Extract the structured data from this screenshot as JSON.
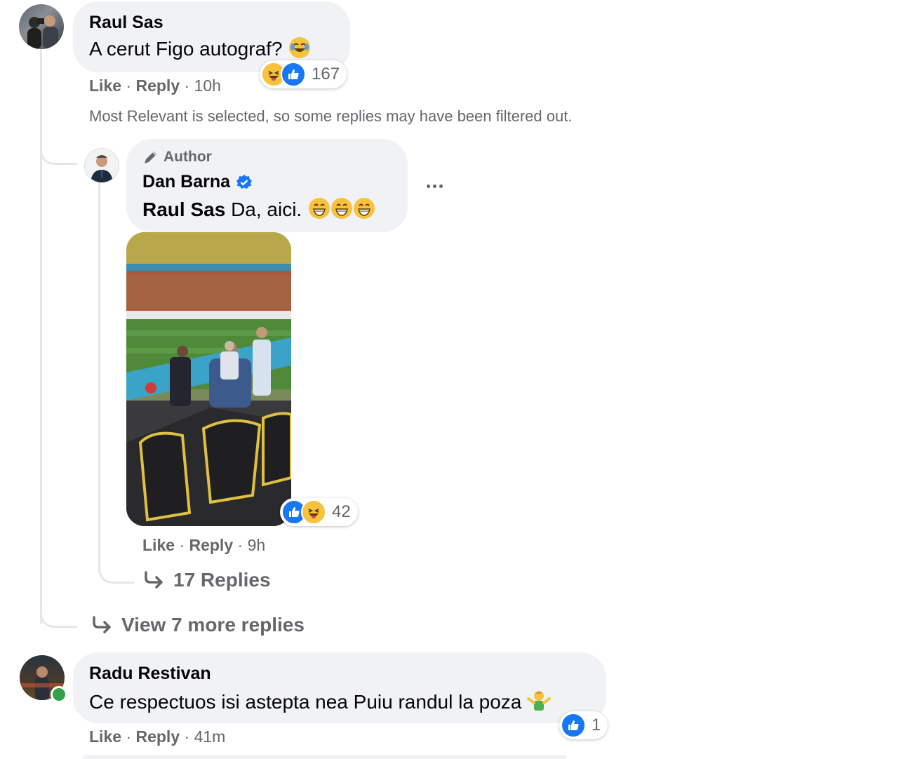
{
  "comments": [
    {
      "author": "Raul Sas",
      "text": "A cerut Figo autograf?",
      "like": "Like",
      "reply": "Reply",
      "time": "10h",
      "reaction_count": "167"
    }
  ],
  "filter_notice": "Most Relevant is selected, so some replies may have been filtered out.",
  "reply": {
    "badge": "Author",
    "author": "Dan Barna",
    "mention": "Raul Sas",
    "text": "Da, aici.",
    "like": "Like",
    "reply": "Reply",
    "time": "9h",
    "reaction_count": "42",
    "replies_link": "17 Replies"
  },
  "view_more": "View 7 more replies",
  "comment2": {
    "author": "Radu Restivan",
    "text": "Ce respectuos isi astepta nea Puiu randul la poza",
    "like": "Like",
    "reply": "Reply",
    "time": "41m",
    "reaction_count": "1"
  },
  "colors": {
    "bubble": "#f0f2f5",
    "meta_text": "#65676b",
    "like_blue": "#1877f2",
    "online_green": "#31a24c",
    "haha_yellow": "#f7c23c"
  },
  "icons": [
    "more-options-icon",
    "reply-arrow-icon",
    "verified-icon",
    "author-pen-icon",
    "like-reaction-icon",
    "haha-reaction-icon"
  ]
}
